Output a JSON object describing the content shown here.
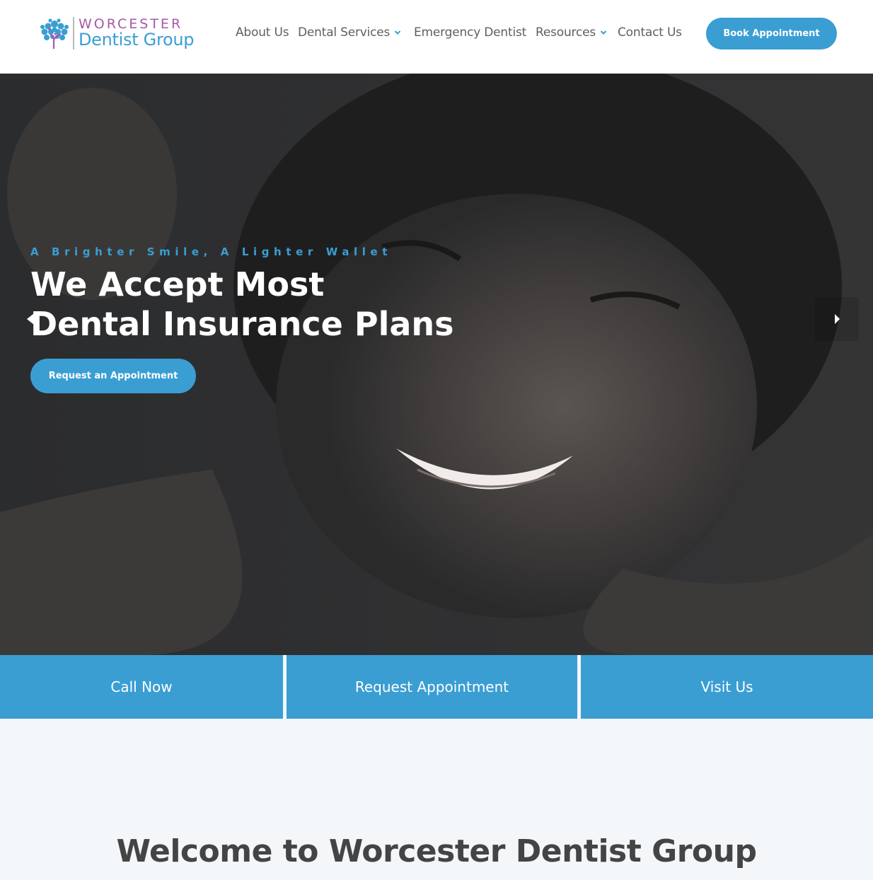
{
  "brand": {
    "logo_top": "WORCESTER",
    "logo_bottom": "Dentist Group",
    "colors": {
      "primary": "#3a9ed3",
      "accent": "#a65aa7",
      "text": "#5f5f5f"
    }
  },
  "nav": {
    "items": [
      {
        "label": "About Us",
        "has_dropdown": false
      },
      {
        "label": "Dental Services",
        "has_dropdown": true
      },
      {
        "label": "Emergency Dentist",
        "has_dropdown": false
      },
      {
        "label": "Resources",
        "has_dropdown": true
      },
      {
        "label": "Contact Us",
        "has_dropdown": false
      }
    ],
    "book_label": "Book Appointment"
  },
  "hero": {
    "eyebrow": "A Brighter Smile, A Lighter Wallet",
    "title_line1": "We Accept Most",
    "title_line2": "Dental Insurance Plans",
    "button_label": "Request an Appointment"
  },
  "cta": {
    "call": "Call Now",
    "request": "Request Appointment",
    "visit": "Visit Us"
  },
  "welcome": {
    "heading": "Welcome to Worcester Dentist Group"
  }
}
